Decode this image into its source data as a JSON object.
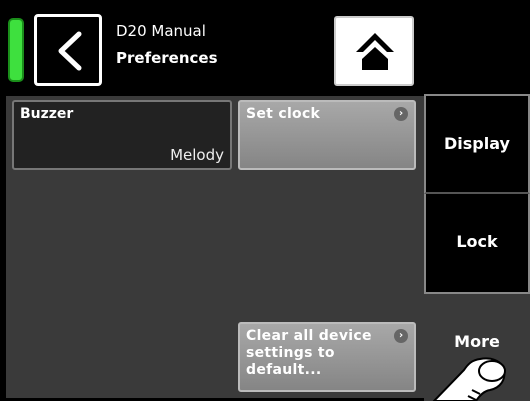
{
  "header": {
    "device_title": "D20 Manual",
    "page_title": "Preferences"
  },
  "tiles": {
    "buzzer": {
      "label": "Buzzer",
      "value": "Melody"
    },
    "set_clock": {
      "label": "Set clock",
      "badge": "›"
    },
    "clear_settings": {
      "label_line1": "Clear all device",
      "label_line2": "settings to",
      "label_line3": "default...",
      "badge": "›"
    }
  },
  "tabs": {
    "display": "Display",
    "lock": "Lock",
    "more": "More"
  },
  "colors": {
    "status_led": "#3ee03e",
    "content_bg": "#3a3a3a",
    "tile_grey": "#9a9a9a"
  },
  "icons": {
    "back": "chevron-left-icon",
    "home": "home-icon",
    "pointer": "hand-pointer-icon"
  }
}
